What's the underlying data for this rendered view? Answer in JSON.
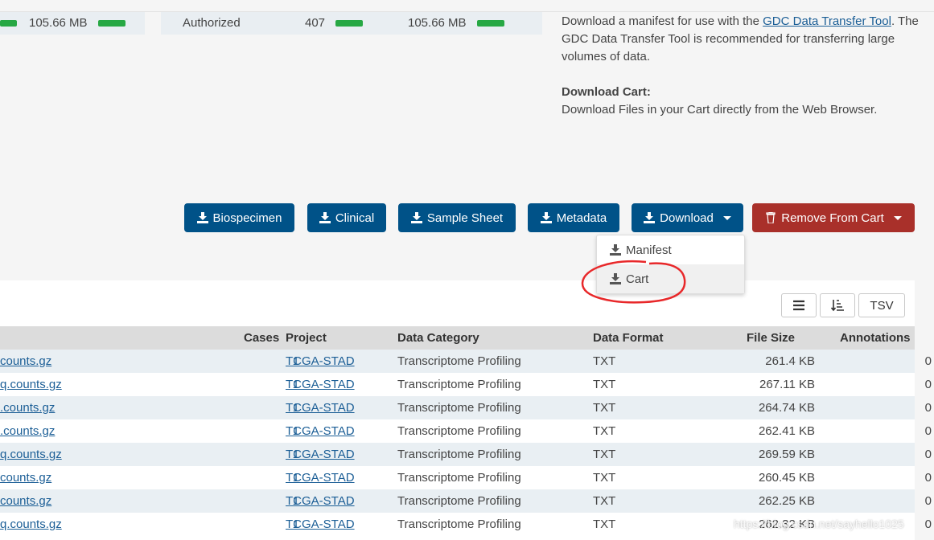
{
  "summary": {
    "left_size": "105.66 MB",
    "access": "Authorized",
    "file_count": "407",
    "right_size": "105.66 MB"
  },
  "info": {
    "manifest_text_before": "Download a manifest for use with the ",
    "manifest_link": "GDC Data Transfer Tool",
    "manifest_text_after": ". The GDC Data Transfer Tool is recommended for transferring large volumes of data.",
    "cart_heading": "Download Cart:",
    "cart_text": "Download Files in your Cart directly from the Web Browser."
  },
  "toolbar": {
    "biospecimen": "Biospecimen",
    "clinical": "Clinical",
    "sample_sheet": "Sample Sheet",
    "metadata": "Metadata",
    "download": "Download",
    "remove_from_cart": "Remove From Cart"
  },
  "dropdown": {
    "items": [
      {
        "label": "Manifest"
      },
      {
        "label": "Cart"
      }
    ]
  },
  "table_tools": {
    "tsv": "TSV"
  },
  "table": {
    "columns": [
      "Cases",
      "Project",
      "Data Category",
      "Data Format",
      "File Size",
      "Annotations"
    ],
    "rows": [
      {
        "file": "counts.gz",
        "cases": "1",
        "project": "TCGA-STAD",
        "category": "Transcriptome Profiling",
        "format": "TXT",
        "size": "261.4 KB",
        "annotations": "0"
      },
      {
        "file": "q.counts.gz",
        "cases": "1",
        "project": "TCGA-STAD",
        "category": "Transcriptome Profiling",
        "format": "TXT",
        "size": "267.11 KB",
        "annotations": "0"
      },
      {
        "file": ".counts.gz",
        "cases": "1",
        "project": "TCGA-STAD",
        "category": "Transcriptome Profiling",
        "format": "TXT",
        "size": "264.74 KB",
        "annotations": "0"
      },
      {
        "file": ".counts.gz",
        "cases": "1",
        "project": "TCGA-STAD",
        "category": "Transcriptome Profiling",
        "format": "TXT",
        "size": "262.41 KB",
        "annotations": "0"
      },
      {
        "file": "q.counts.gz",
        "cases": "1",
        "project": "TCGA-STAD",
        "category": "Transcriptome Profiling",
        "format": "TXT",
        "size": "269.59 KB",
        "annotations": "0"
      },
      {
        "file": "counts.gz",
        "cases": "1",
        "project": "TCGA-STAD",
        "category": "Transcriptome Profiling",
        "format": "TXT",
        "size": "260.45 KB",
        "annotations": "0"
      },
      {
        "file": "counts.gz",
        "cases": "1",
        "project": "TCGA-STAD",
        "category": "Transcriptome Profiling",
        "format": "TXT",
        "size": "262.25 KB",
        "annotations": "0"
      },
      {
        "file": "q.counts.gz",
        "cases": "1",
        "project": "TCGA-STAD",
        "category": "Transcriptome Profiling",
        "format": "TXT",
        "size": "262.32 KB",
        "annotations": "0"
      }
    ]
  },
  "watermark": "https://blog.csdn.net/sayhello1025",
  "colors": {
    "primary_button": "#005288",
    "danger_button": "#a9302a",
    "progress_bar": "#27a844",
    "link": "#1b5e96",
    "annotation_circle": "#e8282a"
  }
}
